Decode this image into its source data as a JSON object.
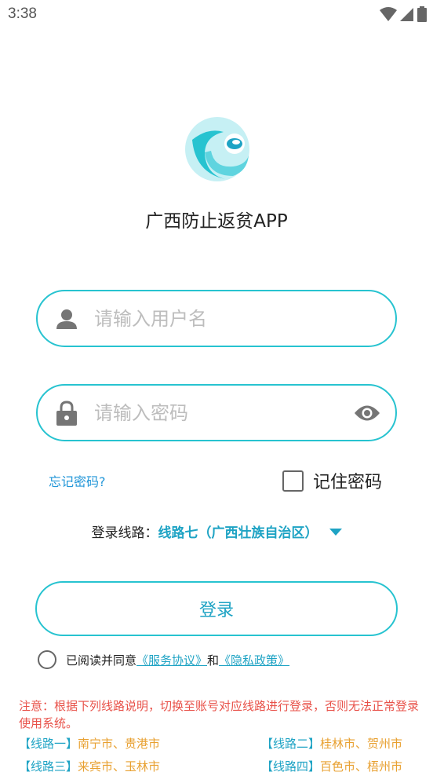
{
  "status_bar": {
    "time": "3:38"
  },
  "app": {
    "name": "广西防止返贫APP"
  },
  "form": {
    "username_placeholder": "请输入用户名",
    "password_placeholder": "请输入密码",
    "forgot_password": "忘记密码?",
    "remember_password": "记住密码"
  },
  "route": {
    "label": "登录线路：",
    "value": "线路七（广西壮族自治区）"
  },
  "login_button": "登录",
  "agreement": {
    "prefix": "已阅读并同意",
    "service": "《服务协议》",
    "and": "和",
    "privacy": "《隐私政策》"
  },
  "notice": "注意：根据下列线路说明，切换至账号对应线路进行登录，否则无法正常登录使用系统。",
  "lines": [
    {
      "tag": "【线路一】",
      "cities": "南宁市、贵港市"
    },
    {
      "tag": "【线路二】",
      "cities": "桂林市、贺州市"
    },
    {
      "tag": "【线路三】",
      "cities": "来宾市、玉林市"
    },
    {
      "tag": "【线路四】",
      "cities": "百色市、梧州市"
    }
  ],
  "colors": {
    "accent": "#27c3d0",
    "link": "#1ea3c4",
    "warning": "#e8524a",
    "cities": "#e8a030"
  }
}
